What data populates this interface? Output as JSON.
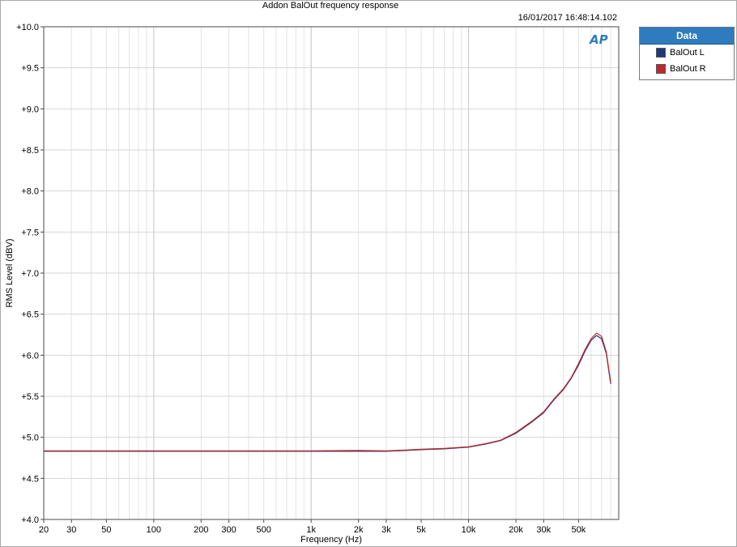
{
  "title": "Addon BalOut frequency response",
  "timestamp": "16/01/2017 16:48:14.102",
  "logo_text": "AP",
  "legend": {
    "header": "Data",
    "items": [
      {
        "label": "BalOut L",
        "color": "#1f3a7a"
      },
      {
        "label": "BalOut R",
        "color": "#c0282d"
      }
    ]
  },
  "chart_data": {
    "type": "line",
    "title": "Addon BalOut frequency response",
    "xlabel": "Frequency (Hz)",
    "ylabel": "RMS Level (dBV)",
    "xscale": "log",
    "xlim": [
      20,
      90000
    ],
    "ylim": [
      4.0,
      10.0
    ],
    "grid": true,
    "legend_placement": "right",
    "x_tick_labels": [
      {
        "value": 20,
        "label": "20"
      },
      {
        "value": 30,
        "label": "30"
      },
      {
        "value": 50,
        "label": "50"
      },
      {
        "value": 100,
        "label": "100"
      },
      {
        "value": 200,
        "label": "200"
      },
      {
        "value": 300,
        "label": "300"
      },
      {
        "value": 500,
        "label": "500"
      },
      {
        "value": 1000,
        "label": "1k"
      },
      {
        "value": 2000,
        "label": "2k"
      },
      {
        "value": 3000,
        "label": "3k"
      },
      {
        "value": 5000,
        "label": "5k"
      },
      {
        "value": 10000,
        "label": "10k"
      },
      {
        "value": 20000,
        "label": "20k"
      },
      {
        "value": 30000,
        "label": "30k"
      },
      {
        "value": 50000,
        "label": "50k"
      }
    ],
    "y_tick_labels": [
      {
        "value": 10.0,
        "label": "+10.0"
      },
      {
        "value": 9.5,
        "label": "+9.5"
      },
      {
        "value": 9.0,
        "label": "+9.0"
      },
      {
        "value": 8.5,
        "label": "+8.5"
      },
      {
        "value": 8.0,
        "label": "+8.0"
      },
      {
        "value": 7.5,
        "label": "+7.5"
      },
      {
        "value": 7.0,
        "label": "+7.0"
      },
      {
        "value": 6.5,
        "label": "+6.5"
      },
      {
        "value": 6.0,
        "label": "+6.0"
      },
      {
        "value": 5.5,
        "label": "+5.5"
      },
      {
        "value": 5.0,
        "label": "+5.0"
      },
      {
        "value": 4.5,
        "label": "+4.5"
      },
      {
        "value": 4.0,
        "label": "+4.0"
      }
    ],
    "series": [
      {
        "name": "BalOut L",
        "color": "#1f3a7a",
        "points": [
          [
            20,
            4.83
          ],
          [
            100,
            4.83
          ],
          [
            500,
            4.83
          ],
          [
            1000,
            4.83
          ],
          [
            2000,
            4.83
          ],
          [
            3000,
            4.83
          ],
          [
            4000,
            4.84
          ],
          [
            5000,
            4.85
          ],
          [
            7000,
            4.86
          ],
          [
            10000,
            4.88
          ],
          [
            13000,
            4.92
          ],
          [
            16000,
            4.96
          ],
          [
            20000,
            5.05
          ],
          [
            25000,
            5.18
          ],
          [
            30000,
            5.3
          ],
          [
            35000,
            5.46
          ],
          [
            40000,
            5.58
          ],
          [
            45000,
            5.72
          ],
          [
            50000,
            5.88
          ],
          [
            55000,
            6.05
          ],
          [
            60000,
            6.18
          ],
          [
            65000,
            6.24
          ],
          [
            70000,
            6.2
          ],
          [
            75000,
            6.02
          ],
          [
            80000,
            5.65
          ]
        ]
      },
      {
        "name": "BalOut R",
        "color": "#c0282d",
        "points": [
          [
            20,
            4.835
          ],
          [
            100,
            4.835
          ],
          [
            500,
            4.835
          ],
          [
            1000,
            4.835
          ],
          [
            2000,
            4.84
          ],
          [
            3000,
            4.835
          ],
          [
            4000,
            4.845
          ],
          [
            5000,
            4.855
          ],
          [
            7000,
            4.865
          ],
          [
            10000,
            4.885
          ],
          [
            13000,
            4.925
          ],
          [
            16000,
            4.965
          ],
          [
            20000,
            5.06
          ],
          [
            25000,
            5.19
          ],
          [
            30000,
            5.31
          ],
          [
            35000,
            5.47
          ],
          [
            40000,
            5.59
          ],
          [
            45000,
            5.73
          ],
          [
            50000,
            5.9
          ],
          [
            55000,
            6.07
          ],
          [
            60000,
            6.2
          ],
          [
            65000,
            6.27
          ],
          [
            70000,
            6.23
          ],
          [
            75000,
            6.04
          ],
          [
            80000,
            5.67
          ]
        ]
      }
    ]
  }
}
